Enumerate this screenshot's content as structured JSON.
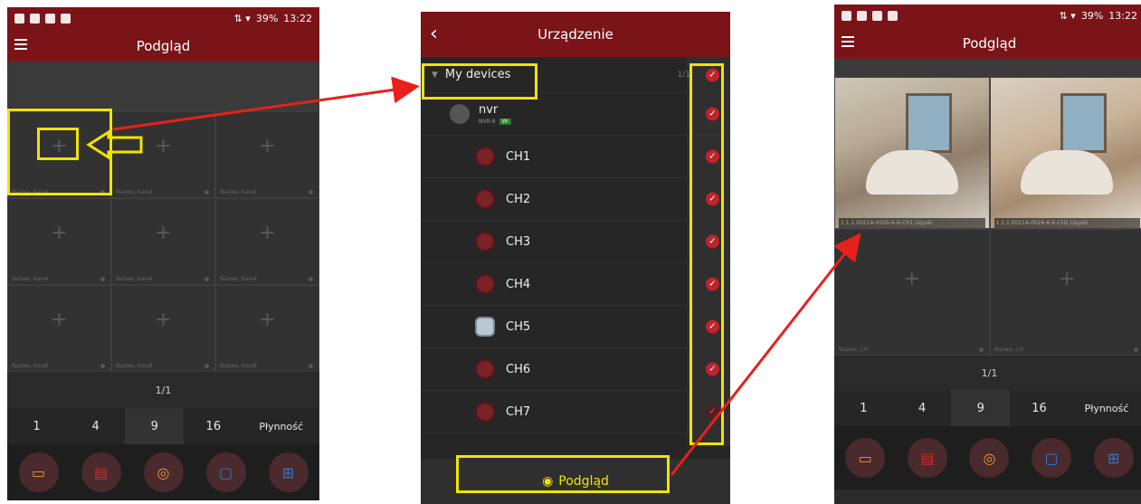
{
  "left_phone": {
    "status": {
      "battery": "39%",
      "time": "13:22"
    },
    "title": "Podgląd",
    "cell_label": "Nazwa, Kanał",
    "pager": "1/1",
    "layouts": [
      "1",
      "4",
      "9",
      "16",
      "Płynność"
    ]
  },
  "middle_phone": {
    "title": "Urządzenie",
    "root": {
      "label": "My devices",
      "count": "1/1"
    },
    "device": {
      "name": "nvr",
      "model": "NVR-9",
      "tag": "Wi"
    },
    "channels": [
      "CH1",
      "CH2",
      "CH3",
      "CH4",
      "CH5",
      "CH6",
      "CH7"
    ],
    "preview_button": "Podgląd"
  },
  "right_phone": {
    "status": {
      "battery": "39%",
      "time": "13:22"
    },
    "title": "Podgląd",
    "video_labels": [
      "1.1.1.0021A-0026-6-6-CH1 Uzyski",
      "1.1.1.0021A-0026-6-6-CH2 Uzyski"
    ],
    "empty_label": "Nazwa, CH",
    "pager": "1/1",
    "layouts": [
      "1",
      "4",
      "9",
      "16",
      "Płynność"
    ]
  },
  "colors": {
    "header": "#7a1418",
    "highlight": "#f2e300",
    "arrow": "#e8201c",
    "check": "#c0232b"
  }
}
